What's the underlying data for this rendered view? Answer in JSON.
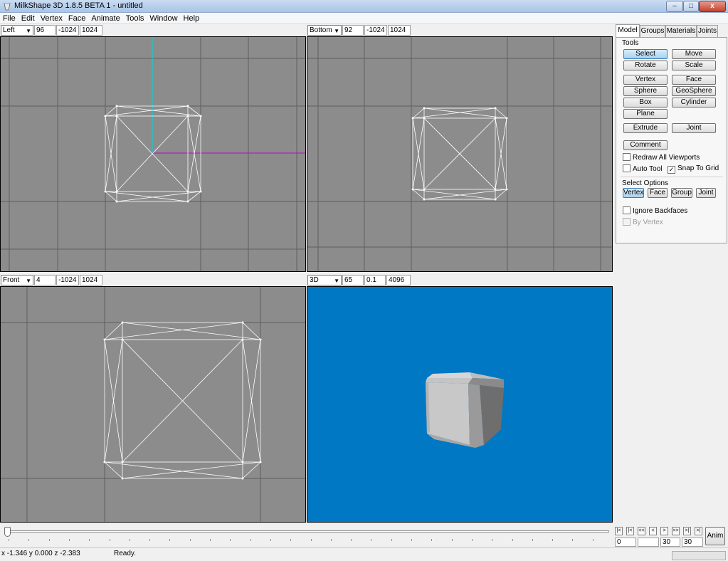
{
  "window": {
    "title": "MilkShape 3D 1.8.5 BETA 1 - untitled",
    "controls": {
      "minimize": "–",
      "maximize": "□",
      "close": "x"
    }
  },
  "menu": [
    "File",
    "Edit",
    "Vertex",
    "Face",
    "Animate",
    "Tools",
    "Window",
    "Help"
  ],
  "viewports": {
    "left": {
      "view": "Left",
      "zoom": "96",
      "min": "-1024",
      "max": "1024"
    },
    "bottom": {
      "view": "Bottom",
      "zoom": "92",
      "min": "-1024",
      "max": "1024"
    },
    "front": {
      "view": "Front",
      "zoom": "4",
      "min": "-1024",
      "max": "1024"
    },
    "perspective": {
      "view": "3D",
      "fov": "65",
      "near": "0.1",
      "far": "4096"
    }
  },
  "colors": {
    "ortho_bg": "#8c8c8c",
    "grid_line": "#5e5e5e",
    "wire": "#ffffff",
    "axis_y": "#00d8d8",
    "axis_x": "#c800c8",
    "viewport_3d_bg": "#0078c4"
  },
  "panel": {
    "tabs": [
      "Model",
      "Groups",
      "Materials",
      "Joints"
    ],
    "active_tab": "Model",
    "tools_label": "Tools",
    "tools": {
      "select": "Select",
      "move": "Move",
      "rotate": "Rotate",
      "scale": "Scale",
      "vertex": "Vertex",
      "face": "Face",
      "sphere": "Sphere",
      "geosphere": "GeoSphere",
      "box": "Box",
      "cylinder": "Cylinder",
      "plane": "Plane",
      "extrude": "Extrude",
      "joint": "Joint",
      "comment": "Comment"
    },
    "redraw_all": {
      "label": "Redraw All Viewports",
      "checked": false
    },
    "auto_tool": {
      "label": "Auto Tool",
      "checked": false
    },
    "snap_to_grid": {
      "label": "Snap To Grid",
      "checked": true
    },
    "select_options_label": "Select Options",
    "select_options": {
      "vertex": "Vertex",
      "face": "Face",
      "group": "Group",
      "joint": "Joint"
    },
    "ignore_backfaces": {
      "label": "Ignore Backfaces",
      "checked": false
    },
    "by_vertex": {
      "label": "By Vertex",
      "checked": false
    },
    "check_mark": "✓"
  },
  "animation": {
    "buttons": [
      "|<",
      "|<",
      "<<",
      "<",
      ">",
      ">>",
      ">|",
      ">|"
    ],
    "current_frame": "0",
    "frame_field_2": "30",
    "total_frames": "30",
    "anim_label": "Anim"
  },
  "status": {
    "coords": "x -1.346 y 0.000 z -2.383",
    "message": "Ready."
  }
}
